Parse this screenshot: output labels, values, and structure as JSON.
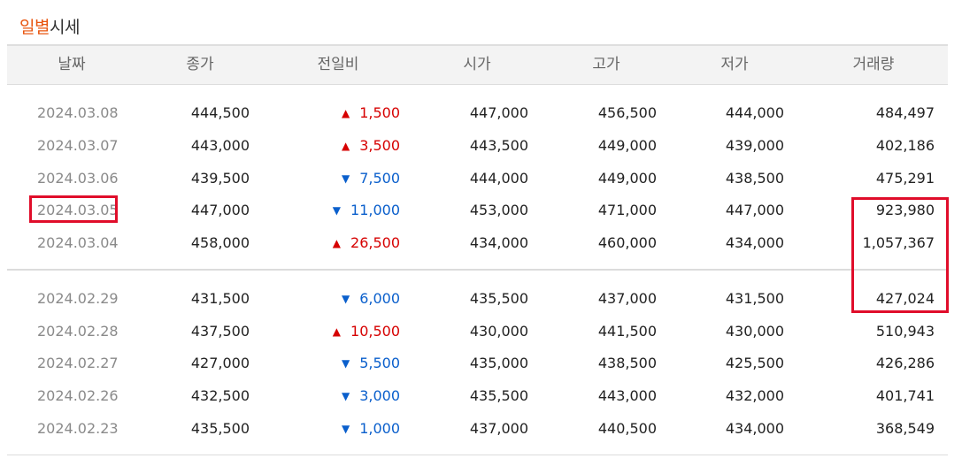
{
  "title": {
    "part1": "일별",
    "part2": "시세"
  },
  "columns": [
    "날짜",
    "종가",
    "전일비",
    "시가",
    "고가",
    "저가",
    "거래량"
  ],
  "colors": {
    "accent": "#e8550f",
    "up": "#d60000",
    "down": "#0a5fcc",
    "highlight": "#e00d2a"
  },
  "icons": {
    "up": "triangle-up-icon",
    "down": "triangle-down-icon"
  },
  "rows": [
    {
      "date": "2024.03.08",
      "close": "444,500",
      "dir": "up",
      "change": "1,500",
      "open": "447,000",
      "high": "456,500",
      "low": "444,000",
      "volume": "484,497"
    },
    {
      "date": "2024.03.07",
      "close": "443,000",
      "dir": "up",
      "change": "3,500",
      "open": "443,500",
      "high": "449,000",
      "low": "439,000",
      "volume": "402,186"
    },
    {
      "date": "2024.03.06",
      "close": "439,500",
      "dir": "down",
      "change": "7,500",
      "open": "444,000",
      "high": "449,000",
      "low": "438,500",
      "volume": "475,291"
    },
    {
      "date": "2024.03.05",
      "close": "447,000",
      "dir": "down",
      "change": "11,000",
      "open": "453,000",
      "high": "471,000",
      "low": "447,000",
      "volume": "923,980"
    },
    {
      "date": "2024.03.04",
      "close": "458,000",
      "dir": "up",
      "change": "26,500",
      "open": "434,000",
      "high": "460,000",
      "low": "434,000",
      "volume": "1,057,367"
    },
    {
      "date": "2024.02.29",
      "close": "431,500",
      "dir": "down",
      "change": "6,000",
      "open": "435,500",
      "high": "437,000",
      "low": "431,500",
      "volume": "427,024"
    },
    {
      "date": "2024.02.28",
      "close": "437,500",
      "dir": "up",
      "change": "10,500",
      "open": "430,000",
      "high": "441,500",
      "low": "430,000",
      "volume": "510,943"
    },
    {
      "date": "2024.02.27",
      "close": "427,000",
      "dir": "down",
      "change": "5,500",
      "open": "435,000",
      "high": "438,500",
      "low": "425,500",
      "volume": "426,286"
    },
    {
      "date": "2024.02.26",
      "close": "432,500",
      "dir": "down",
      "change": "3,000",
      "open": "435,500",
      "high": "443,000",
      "low": "432,000",
      "volume": "401,741"
    },
    {
      "date": "2024.02.23",
      "close": "435,500",
      "dir": "down",
      "change": "1,000",
      "open": "437,000",
      "high": "440,500",
      "low": "434,000",
      "volume": "368,549"
    }
  ]
}
